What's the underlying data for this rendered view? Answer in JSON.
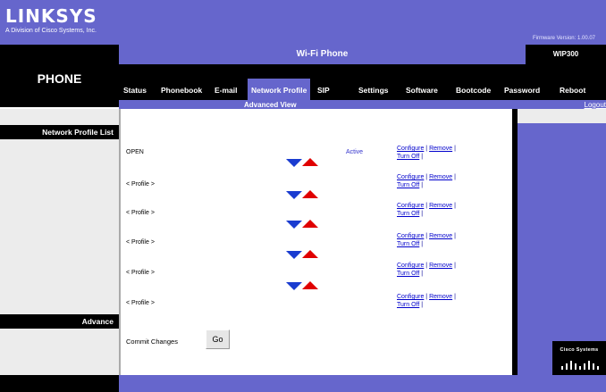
{
  "header": {
    "logo": "LINKSYS",
    "logo_sub": "A Division of Cisco Systems, Inc.",
    "firmware": "Firmware Version: 1.00.07"
  },
  "sidebar": {
    "product": "PHONE",
    "sections": [
      "Network Profile List",
      "Advance"
    ]
  },
  "title_bar": {
    "title": "Wi-Fi Phone",
    "model": "WIP300"
  },
  "menu": {
    "items": [
      "Status",
      "Phonebook",
      "E-mail",
      "Network Profile",
      "SIP",
      "Settings",
      "Software",
      "Bootcode",
      "Password",
      "Reboot"
    ],
    "active": "Network Profile"
  },
  "sub_bar": {
    "label": "Advanced View",
    "logout": "Logout"
  },
  "profiles": [
    {
      "name": "OPEN",
      "status": "Active",
      "configure": "Configure",
      "remove": "Remove",
      "turn_off": "Turn Off"
    },
    {
      "name": "< Profile >",
      "status": "",
      "configure": "Configure",
      "remove": "Remove",
      "turn_off": "Turn Off"
    },
    {
      "name": "< Profile >",
      "status": "",
      "configure": "Configure",
      "remove": "Remove",
      "turn_off": "Turn Off"
    },
    {
      "name": "< Profile >",
      "status": "",
      "configure": "Configure",
      "remove": "Remove",
      "turn_off": "Turn Off"
    },
    {
      "name": "< Profile >",
      "status": "",
      "configure": "Configure",
      "remove": "Remove",
      "turn_off": "Turn Off"
    },
    {
      "name": "< Profile >",
      "status": "",
      "configure": "Configure",
      "remove": "Remove",
      "turn_off": "Turn Off"
    }
  ],
  "commit": {
    "label": "Commit Changes",
    "button": "Go"
  },
  "brand": {
    "cisco_text": "Cisco Systems"
  },
  "colors": {
    "accent": "#6666cc",
    "header_black": "#000000",
    "arrow_down": "#1a3cd0",
    "arrow_up": "#e00000",
    "link": "#0000cc"
  }
}
